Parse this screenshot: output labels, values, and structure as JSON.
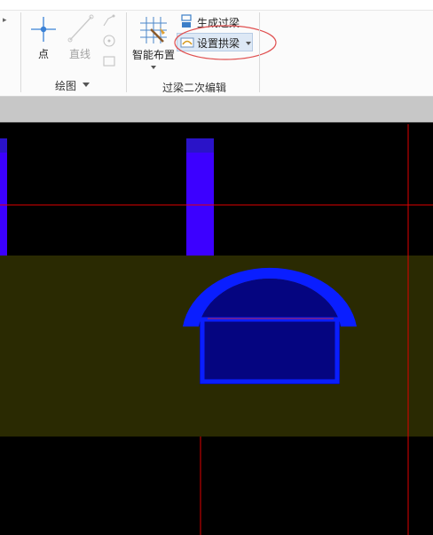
{
  "ribbon": {
    "draw_group": {
      "point_label": "点",
      "line_label": "直线",
      "group_label": "绘图"
    },
    "secondary_edit_group": {
      "smart_layout_label": "智能布置",
      "generate_beam_label": "生成过梁",
      "set_arch_beam_label": "设置拱梁",
      "group_label": "过梁二次编辑"
    }
  },
  "colors": {
    "column": "#3c00ff",
    "slab": "#2a2a02",
    "arch_outer": "#0a1eff",
    "opening": "#050580",
    "axis": "#e00000",
    "highlight_ellipse": "#e05050"
  }
}
